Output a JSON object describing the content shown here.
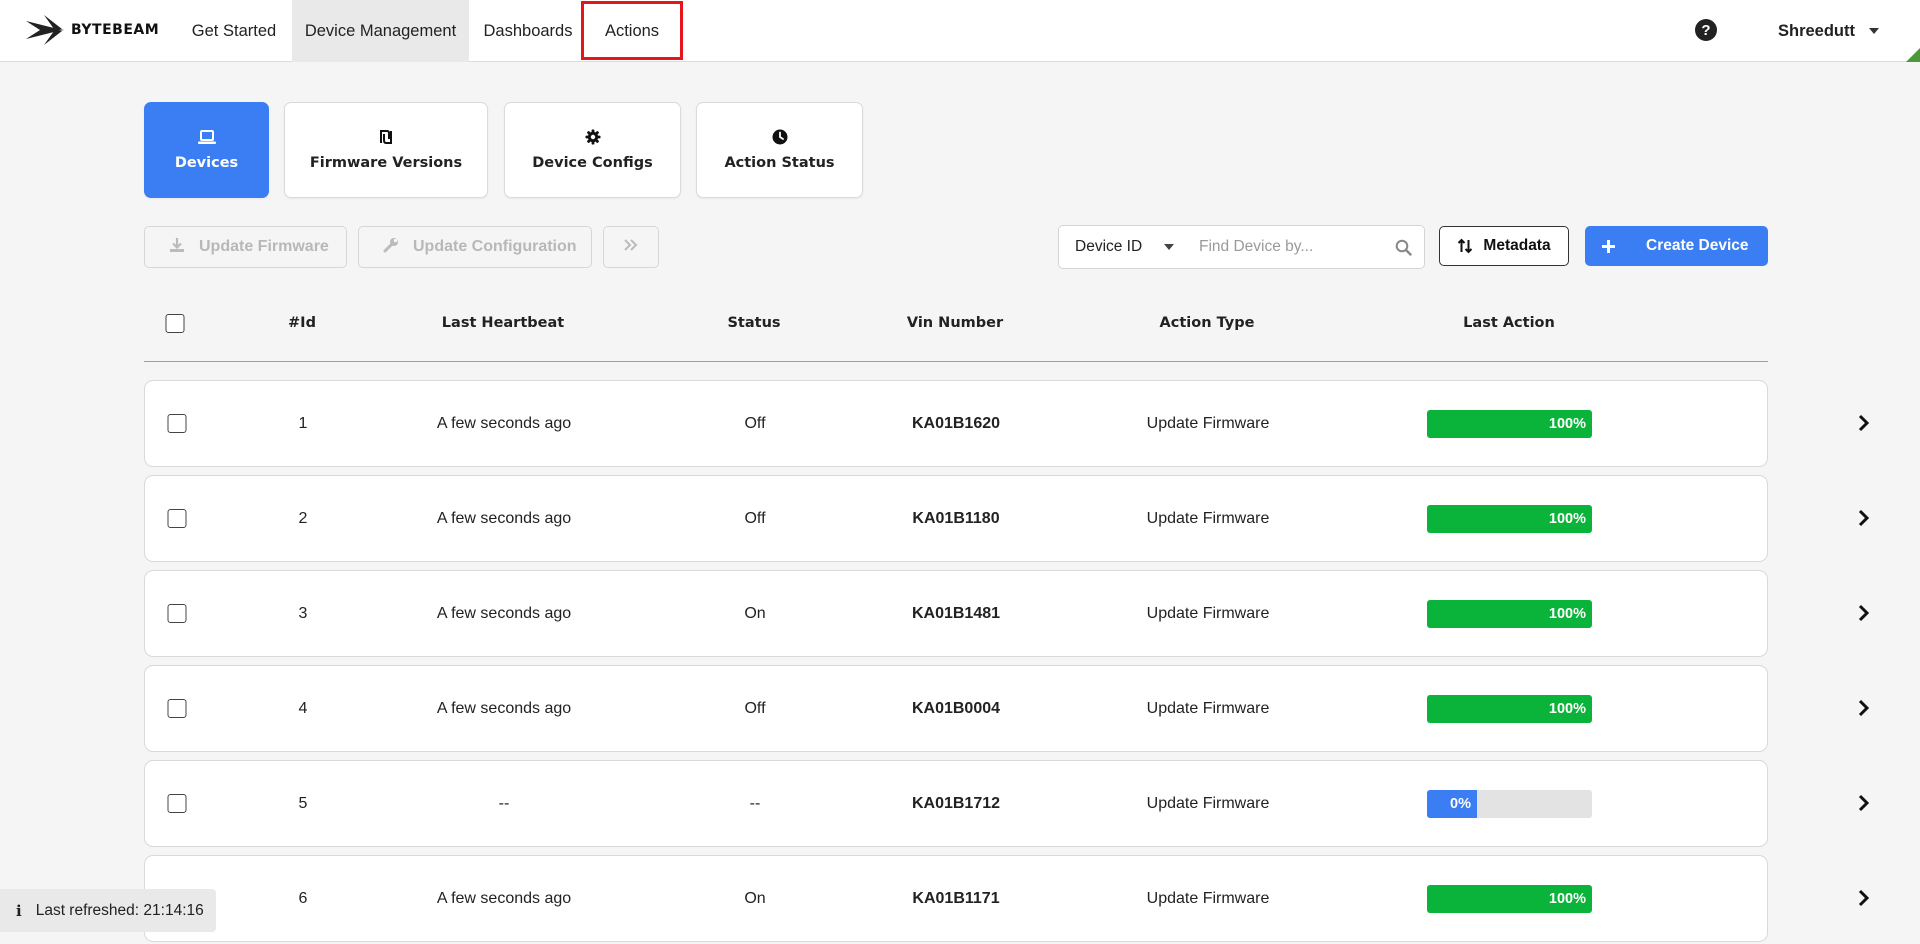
{
  "brand": {
    "name": "BYTEBEAM"
  },
  "nav": {
    "items": [
      {
        "label": "Get Started"
      },
      {
        "label": "Device Management"
      },
      {
        "label": "Dashboards"
      },
      {
        "label": "Actions"
      }
    ],
    "help_icon": "question-circle-icon",
    "help_glyph": "?",
    "user": "Shreedutt"
  },
  "tabs": [
    {
      "label": "Devices",
      "icon": "laptop-icon"
    },
    {
      "label": "Firmware Versions",
      "icon": "shekel-icon"
    },
    {
      "label": "Device Configs",
      "icon": "gear-icon"
    },
    {
      "label": "Action Status",
      "icon": "clock-icon"
    }
  ],
  "toolbar": {
    "update_firmware": "Update Firmware",
    "update_configuration": "Update Configuration",
    "more_icon": "double-chevron-right-icon",
    "search_field": "Device ID",
    "search_placeholder": "Find Device by...",
    "metadata": "Metadata",
    "create_device": "Create Device"
  },
  "table": {
    "columns": [
      "#Id",
      "Last Heartbeat",
      "Status",
      "Vin Number",
      "Action Type",
      "Last Action"
    ],
    "rows": [
      {
        "id": "1",
        "heartbeat": "A few seconds ago",
        "status": "Off",
        "vin": "KA01B1620",
        "action_type": "Update Firmware",
        "progress_label": "100%",
        "progress": 100
      },
      {
        "id": "2",
        "heartbeat": "A few seconds ago",
        "status": "Off",
        "vin": "KA01B1180",
        "action_type": "Update Firmware",
        "progress_label": "100%",
        "progress": 100
      },
      {
        "id": "3",
        "heartbeat": "A few seconds ago",
        "status": "On",
        "vin": "KA01B1481",
        "action_type": "Update Firmware",
        "progress_label": "100%",
        "progress": 100
      },
      {
        "id": "4",
        "heartbeat": "A few seconds ago",
        "status": "Off",
        "vin": "KA01B0004",
        "action_type": "Update Firmware",
        "progress_label": "100%",
        "progress": 100
      },
      {
        "id": "5",
        "heartbeat": "--",
        "status": "--",
        "vin": "KA01B1712",
        "action_type": "Update Firmware",
        "progress_label": "0%",
        "progress": 0
      },
      {
        "id": "6",
        "heartbeat": "A few seconds ago",
        "status": "On",
        "vin": "KA01B1171",
        "action_type": "Update Firmware",
        "progress_label": "100%",
        "progress": 100
      }
    ]
  },
  "toast": {
    "icon": "info-icon",
    "glyph": "i",
    "text": "Last refreshed: 21:14:16"
  },
  "colors": {
    "primary": "#3b7df2",
    "success": "#0ab33a",
    "highlight": "#e8141b"
  }
}
